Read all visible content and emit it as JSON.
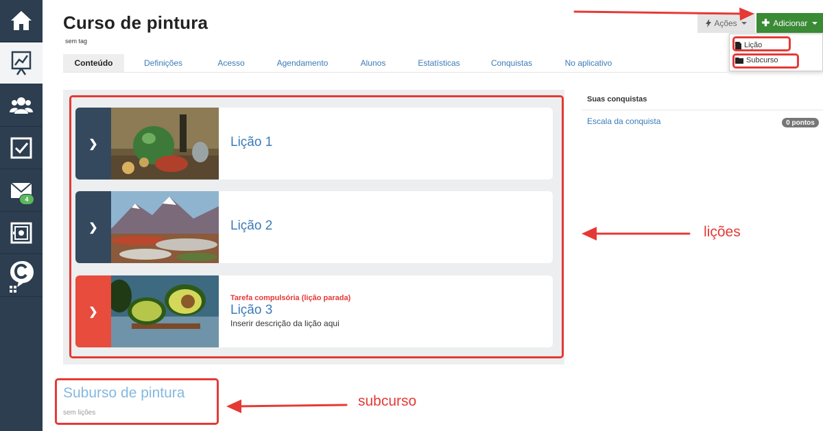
{
  "header": {
    "title": "Curso de pintura",
    "tag": "sem tag",
    "actions_label": "Ações",
    "add_label": "Adicionar"
  },
  "dropdown": {
    "items": [
      {
        "label": "Lição",
        "icon": "file-icon"
      },
      {
        "label": "Subcurso",
        "icon": "folder-icon"
      }
    ]
  },
  "sidebar": {
    "items": [
      {
        "icon": "home-icon"
      },
      {
        "icon": "course-chart-icon",
        "active": true
      },
      {
        "icon": "users-icon"
      },
      {
        "icon": "checkbox-icon"
      },
      {
        "icon": "mail-icon",
        "badge": "4"
      },
      {
        "icon": "safe-icon"
      },
      {
        "icon": "chat-c-icon"
      }
    ]
  },
  "tabs": [
    {
      "label": "Conteúdo",
      "active": true
    },
    {
      "label": "Definições"
    },
    {
      "label": "Acesso"
    },
    {
      "label": "Agendamento"
    },
    {
      "label": "Alunos"
    },
    {
      "label": "Estatísticas"
    },
    {
      "label": "Conquistas"
    },
    {
      "label": "No aplicativo"
    }
  ],
  "lessons": [
    {
      "name": "Lição 1",
      "bar_color": "#34495e"
    },
    {
      "name": "Lição 2",
      "bar_color": "#34495e"
    },
    {
      "name": "Lição 3",
      "bar_color": "#e74c3c",
      "warning": "Tarefa compulsória (lição parada)",
      "description": "Inserir descrição da lição aqui"
    }
  ],
  "achievements": {
    "title": "Suas conquistas",
    "link": "Escala da conquista",
    "points": "0 pontos"
  },
  "subcourse": {
    "title": "Suburso de pintura",
    "subtitle": "sem lições"
  },
  "annotations": {
    "lessons_label": "lições",
    "subcourse_label": "subcurso"
  },
  "colors": {
    "sidebar": "#2c3e50",
    "accent_blue": "#3a7ab8",
    "add_button": "#3a8a36",
    "annotation_red": "#e53935"
  }
}
